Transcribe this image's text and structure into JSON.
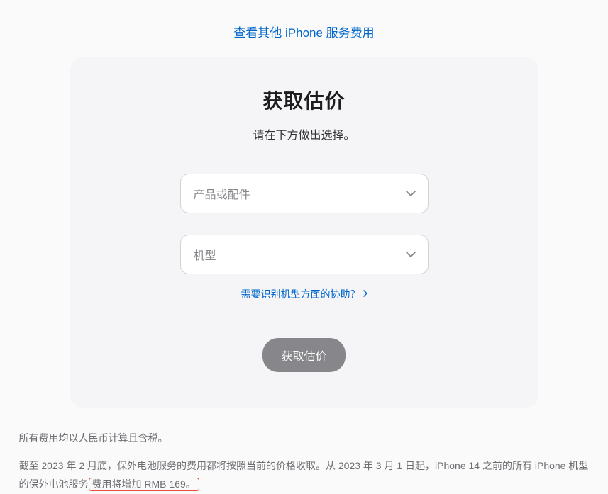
{
  "topLink": {
    "label": "查看其他 iPhone 服务费用"
  },
  "card": {
    "title": "获取估价",
    "subtitle": "请在下方做出选择。",
    "selectProduct": {
      "placeholder": "产品或配件"
    },
    "selectModel": {
      "placeholder": "机型"
    },
    "helpLink": {
      "label": "需要识别机型方面的协助？"
    },
    "button": {
      "label": "获取估价"
    }
  },
  "footer": {
    "line1": "所有费用均以人民币计算且含税。",
    "line2_part1": "截至 2023 年 2 月底，保外电池服务的费用都将按照当前的价格收取。从 2023 年 3 月 1 日起，iPhone 14 之前的所有 iPhone 机型的保外电池服务",
    "line2_highlight": "费用将增加 RMB 169。"
  }
}
